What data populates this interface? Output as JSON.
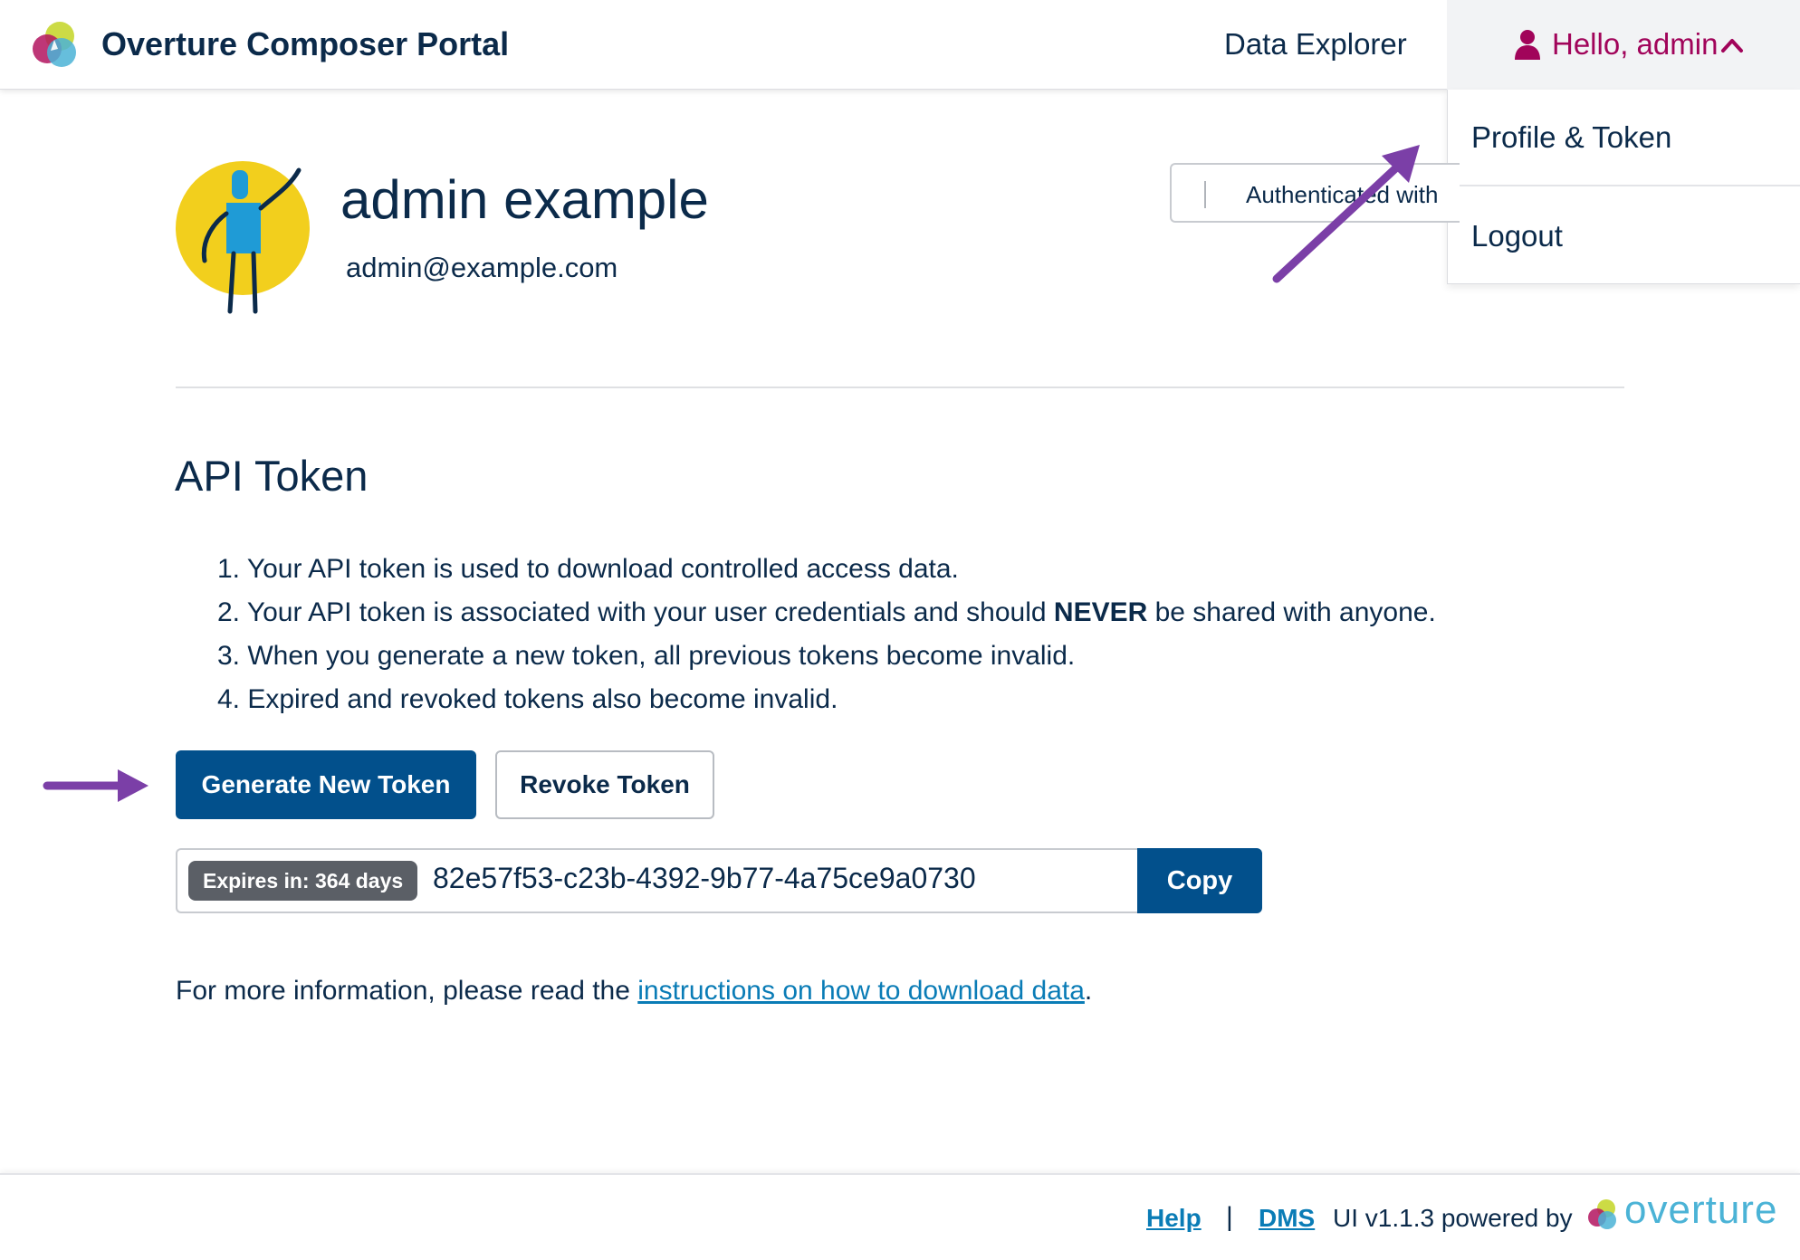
{
  "header": {
    "title": "Overture Composer Portal",
    "nav_data_explorer": "Data Explorer",
    "user_greeting": "Hello, admin"
  },
  "dropdown": {
    "items": [
      {
        "label": "Profile & Token"
      },
      {
        "label": "Logout"
      }
    ]
  },
  "profile": {
    "name": "admin example",
    "email": "admin@example.com",
    "auth_text": "Authenticated with"
  },
  "api_token": {
    "title": "API Token",
    "instructions": {
      "item1": "1. Your API token is used to download controlled access data.",
      "item2_prefix": "2. Your API token is associated with your user credentials and should ",
      "item2_bold": "NEVER",
      "item2_suffix": " be shared with anyone.",
      "item3": "3. When you generate a new token, all previous tokens become invalid.",
      "item4": "4. Expired and revoked tokens also become invalid."
    },
    "generate_label": "Generate New Token",
    "revoke_label": "Revoke Token",
    "expires_label": "Expires in: 364 days",
    "token_value": "82e57f53-c23b-4392-9b77-4a75ce9a0730",
    "copy_label": "Copy",
    "more_info_prefix": "For more information, please read the ",
    "more_info_link": "instructions on how to download data",
    "more_info_suffix": "."
  },
  "footer": {
    "help": "Help",
    "separator": "|",
    "dms": "DMS",
    "version": "UI v1.1.3 powered by",
    "brand": "overture"
  },
  "colors": {
    "primary": "#02508c",
    "greeting": "#a1045a",
    "link": "#0a7cb6",
    "annotation_arrow": "#7b3fa7"
  }
}
